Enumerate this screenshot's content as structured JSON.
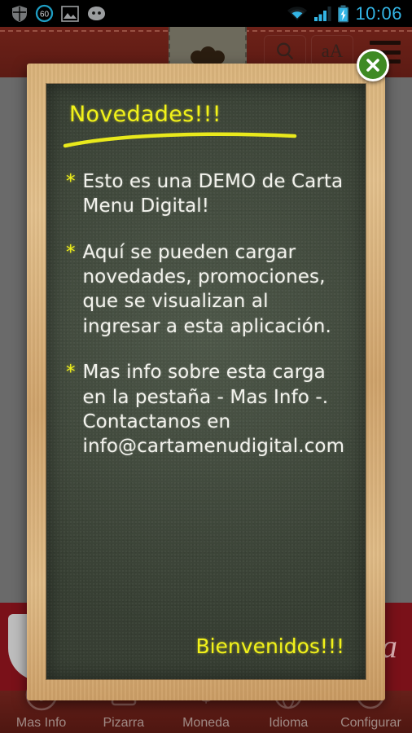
{
  "statusbar": {
    "icons_left": [
      "shield-icon",
      "battery-saver-60-icon",
      "gallery-image-icon",
      "android-robot-icon"
    ],
    "battery_saver_value": "60",
    "icons_right": [
      "wifi-icon",
      "cellular-signal-icon",
      "battery-charging-icon"
    ],
    "clock": "10:06"
  },
  "appbar": {
    "logo": "chef-hat-logo",
    "search_label": "search-icon",
    "textsize_label": "aA",
    "menu_label": "menu-icon"
  },
  "background": {
    "ad_text": "Cola",
    "rows": [
      {
        "line1": "",
        "line2": ""
      },
      {
        "line1": "",
        "line2": ""
      },
      {
        "line1": "",
        "line2": ""
      }
    ]
  },
  "dialog": {
    "title": "Novedades!!!",
    "close_label": "×",
    "footer": "Bienvenidos!!!",
    "bullet_marker": "*",
    "bullets": [
      "Esto es una DEMO de Carta Menu Digital!",
      "Aquí se pueden cargar novedades, promociones, que se visualizan al ingresar a esta aplicación.",
      "Mas info sobre esta carga en la pestaña - Mas Info -. Contactanos en info@cartamenudigital.com"
    ]
  },
  "bottomnav": {
    "items": [
      {
        "label": "Mas Info",
        "icon": "info-circle-icon"
      },
      {
        "label": "Pizarra",
        "icon": "chalkboard-icon"
      },
      {
        "label": "Moneda",
        "icon": "currency-icon"
      },
      {
        "label": "Idioma",
        "icon": "globe-icon"
      },
      {
        "label": "Configurar",
        "icon": "settings-gear-icon"
      }
    ]
  },
  "colors": {
    "accent_yellow": "#f2f21a",
    "chalkboard_green": "#465041",
    "frame_wood": "#d9b279",
    "appbar_red": "#6d2118",
    "close_green": "#3f8a24",
    "clock_blue": "#33b5e5"
  }
}
